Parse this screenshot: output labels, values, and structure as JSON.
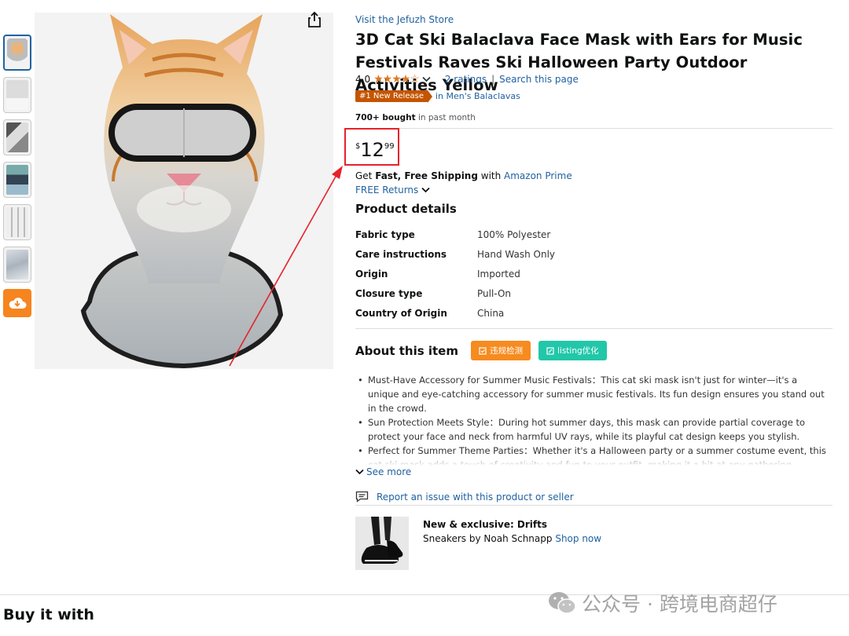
{
  "store_link": "Visit the Jefuzh Store",
  "title": "3D Cat Ski Balaclava Face Mask with Ears for Music Festivals Raves Ski Halloween Party Outdoor Activities Yellow",
  "rating": {
    "value": "4.0",
    "stars_filled": 4,
    "stars_total": 5,
    "ratings_link": "2 ratings",
    "search_link": "Search this page"
  },
  "badge": {
    "label": "#1 New Release",
    "category": "in Men's Balaclavas"
  },
  "bought": {
    "count": "700+ bought",
    "period": "in past month"
  },
  "price": {
    "symbol": "$",
    "whole": "12",
    "fraction": "99"
  },
  "shipping": {
    "prefix": "Get ",
    "bold": "Fast, Free Shipping",
    "middle": " with ",
    "link": "Amazon Prime"
  },
  "returns": "FREE Returns",
  "details_heading": "Product details",
  "details": [
    {
      "key": "Fabric type",
      "value": "100% Polyester"
    },
    {
      "key": "Care instructions",
      "value": "Hand Wash Only"
    },
    {
      "key": "Origin",
      "value": "Imported"
    },
    {
      "key": "Closure type",
      "value": "Pull-On"
    },
    {
      "key": "Country of Origin",
      "value": "China"
    }
  ],
  "about_heading": "About this item",
  "tools": {
    "check": "违规检测",
    "optimize": "listing优化"
  },
  "bullets": [
    "Must-Have Accessory for Summer Music Festivals：This cat ski mask isn't just for winter—it's a unique and eye-catching accessory for summer music festivals. Its fun design ensures you stand out in the crowd.",
    "Sun Protection Meets Style：During hot summer days, this mask can provide partial coverage to protect your face and neck from harmful UV rays, while its playful cat design keeps you stylish.",
    "Perfect for Summer Theme Parties：Whether it's a Halloween party or a summer costume event, this cat ski mask adds a touch of creativity and fun to your outfit, making it a hit at any gathering."
  ],
  "see_more": "See more",
  "report": "Report an issue with this product or seller",
  "promo": {
    "headline": "New & exclusive: Drifts",
    "text": "Sneakers by Noah Schnapp ",
    "link": "Shop now"
  },
  "buy_it_with": "Buy it with",
  "watermark": "公众号 · 跨境电商超仔",
  "colors": {
    "link": "#2162a1",
    "star": "#de7921",
    "badge": "#c45500",
    "annotation": "#e5222b",
    "tool_orange": "#f68b1f",
    "tool_teal": "#21c7a8"
  },
  "icons": [
    "share-icon",
    "download-icon",
    "chevron-down-icon",
    "report-icon",
    "wechat-icon"
  ]
}
